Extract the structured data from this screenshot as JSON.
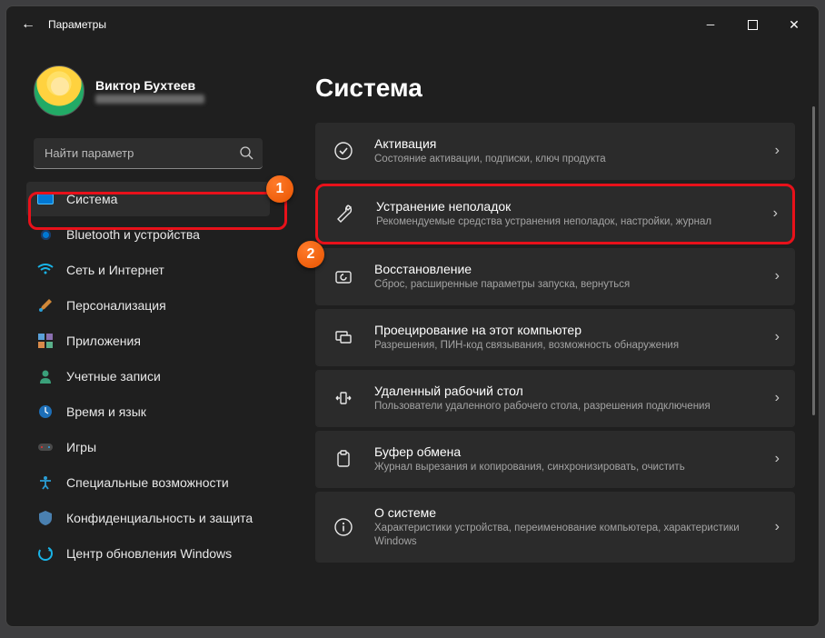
{
  "window": {
    "title": "Параметры"
  },
  "profile": {
    "name": "Виктор Бухтеев"
  },
  "search": {
    "placeholder": "Найти параметр"
  },
  "sidebar": {
    "items": [
      {
        "label": "Система"
      },
      {
        "label": "Bluetooth и устройства"
      },
      {
        "label": "Сеть и Интернет"
      },
      {
        "label": "Персонализация"
      },
      {
        "label": "Приложения"
      },
      {
        "label": "Учетные записи"
      },
      {
        "label": "Время и язык"
      },
      {
        "label": "Игры"
      },
      {
        "label": "Специальные возможности"
      },
      {
        "label": "Конфиденциальность и защита"
      },
      {
        "label": "Центр обновления Windows"
      }
    ]
  },
  "main": {
    "heading": "Система",
    "cards": [
      {
        "title": "Активация",
        "sub": "Состояние активации, подписки, ключ продукта"
      },
      {
        "title": "Устранение неполадок",
        "sub": "Рекомендуемые средства устранения неполадок, настройки, журнал"
      },
      {
        "title": "Восстановление",
        "sub": "Сброс, расширенные параметры запуска, вернуться"
      },
      {
        "title": "Проецирование на этот компьютер",
        "sub": "Разрешения, ПИН-код связывания, возможность обнаружения"
      },
      {
        "title": "Удаленный рабочий стол",
        "sub": "Пользователи удаленного рабочего стола, разрешения подключения"
      },
      {
        "title": "Буфер обмена",
        "sub": "Журнал вырезания и копирования, синхронизировать, очистить"
      },
      {
        "title": "О системе",
        "sub": "Характеристики устройства, переименование компьютера, характеристики Windows"
      }
    ]
  },
  "badges": {
    "one": "1",
    "two": "2"
  }
}
